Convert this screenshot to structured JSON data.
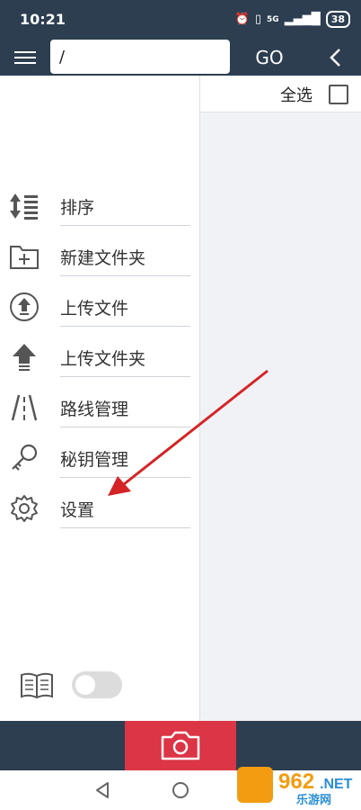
{
  "status_bar": {
    "time": "10:21",
    "network": "5G",
    "battery": "38"
  },
  "app_bar": {
    "path_value": "/",
    "go_label": "GO"
  },
  "select_bar": {
    "select_all_label": "全选"
  },
  "drawer": {
    "items": [
      {
        "label": "排序",
        "icon": "sort-icon"
      },
      {
        "label": "新建文件夹",
        "icon": "new-folder-icon"
      },
      {
        "label": "上传文件",
        "icon": "upload-file-icon"
      },
      {
        "label": "上传文件夹",
        "icon": "upload-folder-icon"
      },
      {
        "label": "路线管理",
        "icon": "route-icon"
      },
      {
        "label": "秘钥管理",
        "icon": "key-icon"
      },
      {
        "label": "设置",
        "icon": "gear-icon"
      }
    ],
    "toggle_on": false
  },
  "watermark": {
    "number": "962",
    "suffix": ".NET",
    "text": "乐游网"
  },
  "colors": {
    "header": "#2c3e50",
    "camera_button": "#dc3545",
    "annotation_arrow": "#d42426"
  }
}
